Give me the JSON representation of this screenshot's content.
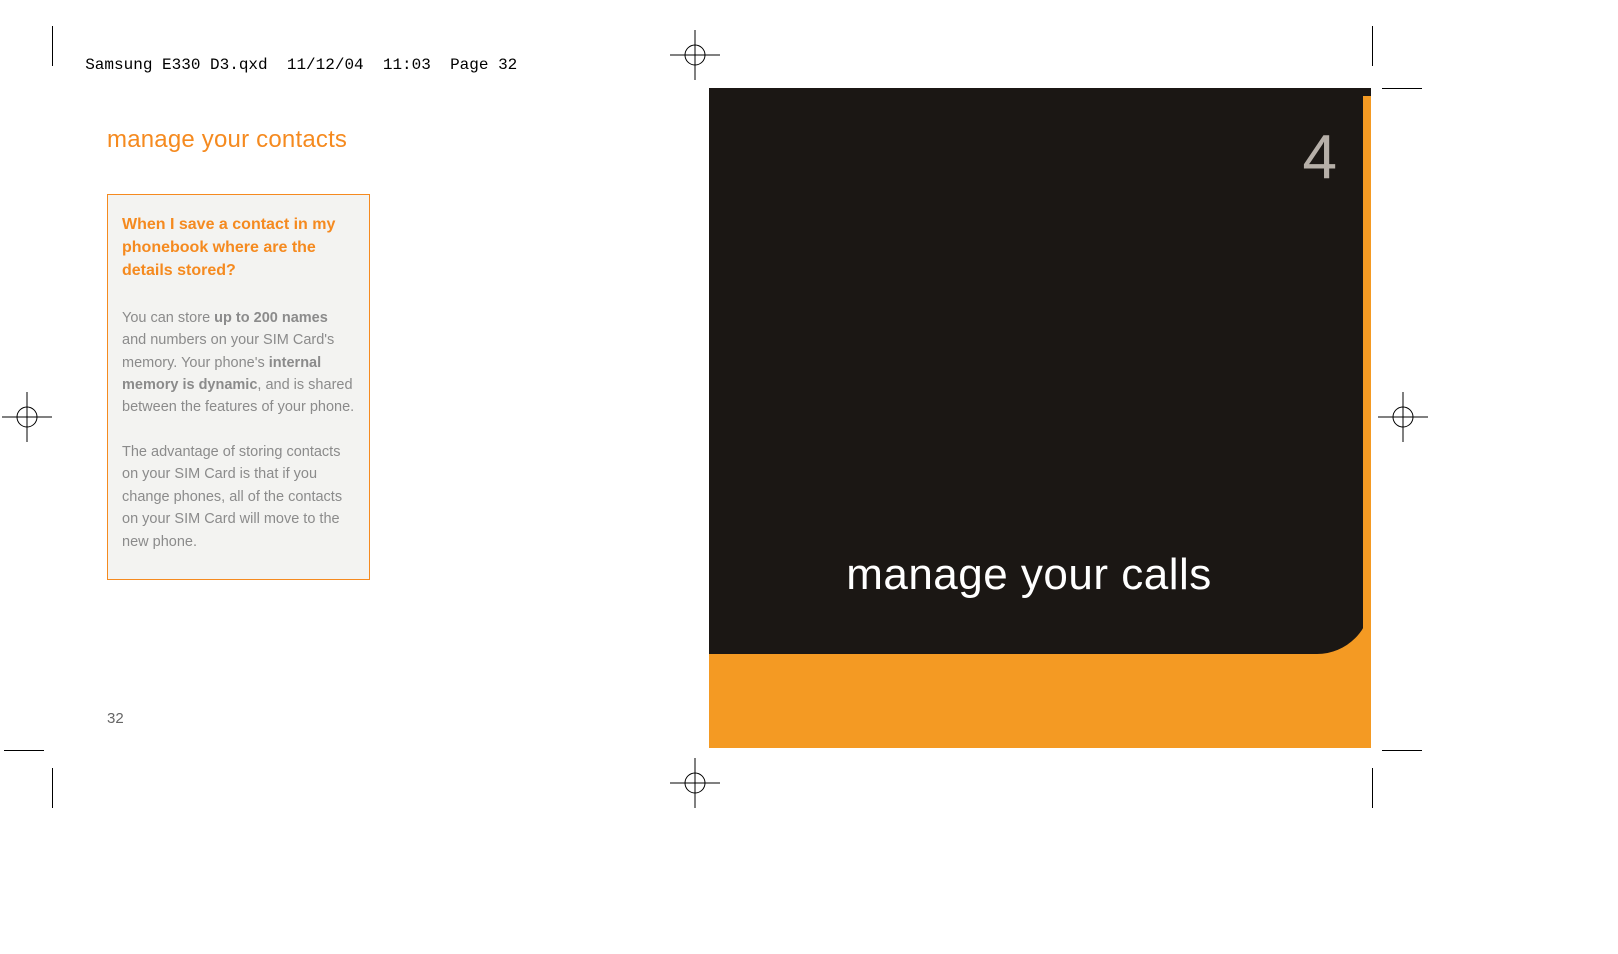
{
  "file_header": "Samsung E330 D3.qxd  11/12/04  11:03  Page 32",
  "left": {
    "title": "manage your contacts",
    "box": {
      "question": "When I save a contact in my phonebook where are the details stored?",
      "para1_pre": "You can store ",
      "para1_b1": "up to 200 names",
      "para1_mid": " and numbers on your SIM Card's memory. Your phone's ",
      "para1_b2": "internal memory is dynamic",
      "para1_post": ", and is shared between the features of your phone.",
      "para2": "The advantage of storing contacts on your SIM Card is that if you change phones, all of the contacts on your SIM Card will move to the new phone."
    },
    "page_number": "32"
  },
  "right": {
    "chapter_number": "4",
    "chapter_title": "manage your calls"
  }
}
